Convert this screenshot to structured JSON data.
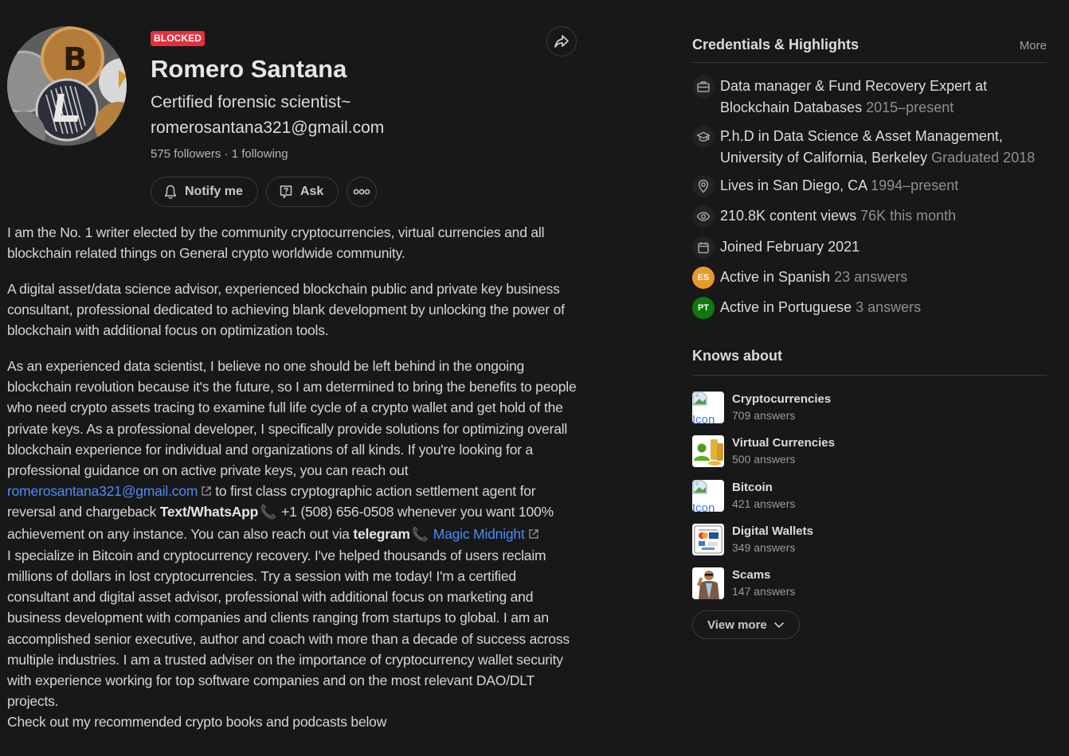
{
  "profile": {
    "status_badge": "BLOCKED",
    "name": "Romero Santana",
    "tagline": "Certified forensic scientist~ romerosantana321@gmail.com",
    "followers": "575 followers",
    "separator": " · ",
    "following": "1 following",
    "avatar_alt": "crypto coins avatar",
    "actions": {
      "notify": "Notify me",
      "ask": "Ask",
      "more_icon": "ellipsis-icon",
      "share_icon": "share-icon"
    }
  },
  "bio": {
    "p1": "I am the No. 1 writer elected by the community cryptocurrencies, virtual currencies and all blockchain related things on General crypto worldwide community.",
    "p2": "A digital asset/data science advisor, experienced blockchain public and private key business consultant, professional dedicated to achieving blank development by unlocking the power of blockchain with additional focus on optimization tools.",
    "p3_a": "As an experienced data scientist, I believe no one should be left behind in the ongoing blockchain revolution because it's the future, so I am determined to bring the benefits to people who need crypto assets tracing to examine full life cycle of a crypto wallet and get hold of the private keys. As a professional developer, I specifically provide solutions for optimizing overall blockchain experience for individual and organizations of all kinds. If you're looking for a professional guidance on on active private keys, you can reach out ",
    "p3_email_link": "romerosantana321@gmail.com",
    "p3_b": "to first class cryptographic action settlement agent for reversal and chargeback ",
    "p3_whatsapp_label": "Text/WhatsApp",
    "p3_phone": "+1 (508) 656-0508",
    "p3_c": " whenever you want 100% achievement on any instance. You can also reach out via ",
    "p3_telegram_label": "telegram",
    "p3_telegram_link": "Magic Midnight",
    "p4": "I specialize in Bitcoin and cryptocurrency recovery. I've helped thousands of users reclaim millions of dollars in lost cryptocurrencies. Try a session with me today! I'm a certified consultant and digital asset advisor, professional with additional focus on marketing and business development with companies and clients ranging from startups to global. I am an accomplished senior executive, author and coach with more than a decade of success across multiple industries. I am a trusted adviser on the importance of cryptocurrency wallet security with experience working for top software companies and on the most relevant DAO/DLT projects.",
    "p5": "Check out my recommended crypto books and podcasts below"
  },
  "credentials": {
    "title": "Credentials & Highlights",
    "more": "More",
    "items": [
      {
        "icon": "briefcase-icon",
        "text": "Data manager & Fund Recovery Expert at Blockchain Databases",
        "muted": "2015–present"
      },
      {
        "icon": "graduation-cap-icon",
        "text": "P.h.D in Data Science & Asset Management, University of California, Berkeley",
        "muted": "Graduated 2018"
      },
      {
        "icon": "location-pin-icon",
        "text": "Lives in San Diego, CA",
        "muted": "1994–present"
      },
      {
        "icon": "eye-icon",
        "text": "210.8K content views",
        "muted": "76K this month"
      },
      {
        "icon": "calendar-icon",
        "text": "Joined February 2021",
        "muted": ""
      },
      {
        "icon": "language-badge-es",
        "badge": "ES",
        "badge_color": "#e99a2a",
        "text": "Active in Spanish",
        "muted": "23 answers"
      },
      {
        "icon": "language-badge-pt",
        "badge": "PT",
        "badge_color": "#0e7a0d",
        "text": "Active in Portuguese",
        "muted": "3 answers"
      }
    ]
  },
  "knows_about": {
    "title": "Knows about",
    "topics": [
      {
        "name": "Cryptocurrencies",
        "count": "709 answers",
        "thumb": "broken-image",
        "alt": "Icon"
      },
      {
        "name": "Virtual Currencies",
        "count": "500 answers",
        "thumb": "user-coins"
      },
      {
        "name": "Bitcoin",
        "count": "421 answers",
        "thumb": "broken-image",
        "alt": "Icon"
      },
      {
        "name": "Digital Wallets",
        "count": "349 answers",
        "thumb": "payment-cards"
      },
      {
        "name": "Scams",
        "count": "147 answers",
        "thumb": "person-photo"
      }
    ],
    "view_more": "View more"
  },
  "colors": {
    "background": "#181818",
    "badge_red": "#e5303c",
    "link_blue": "#4c8bf5",
    "phone_red": "#e8304a"
  }
}
